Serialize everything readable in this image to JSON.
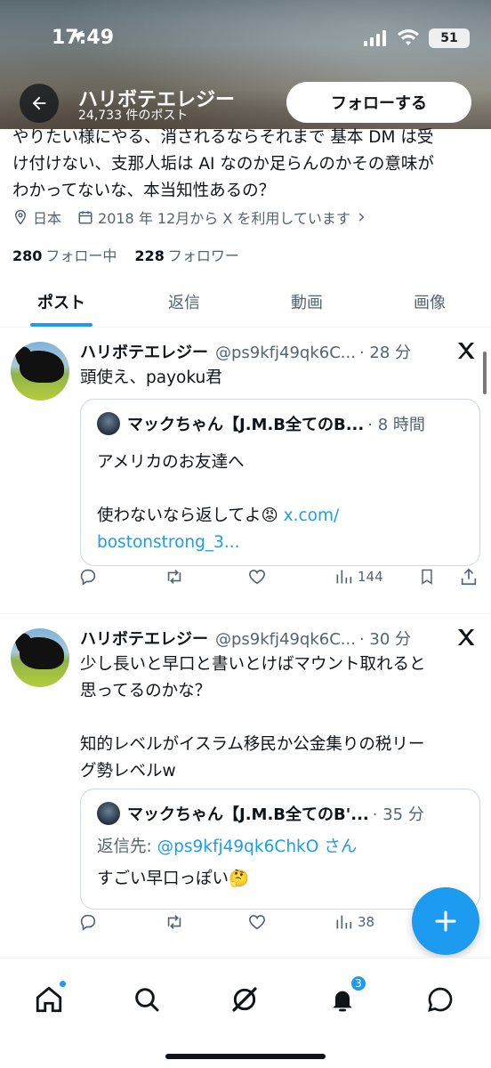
{
  "status_bar": {
    "time": "17:49",
    "battery": "51"
  },
  "header": {
    "name": "ハリボテエレジー",
    "post_count": "24,733 件のポスト",
    "follow_label": "フォローする"
  },
  "profile": {
    "bio_lines": [
      "やりたい様にやる、消されるならそれまで 基本 DM は受",
      "け付けない、支那人垢は AI なのか足らんのかその意味が",
      "わかってないな、本当知性あるの？"
    ],
    "location": "日本",
    "joined": "2018 年 12月から X を利用しています",
    "following_count": "280",
    "following_label": "フォロー中",
    "followers_count": "228",
    "followers_label": "フォロワー"
  },
  "tabs": [
    {
      "label": "ポスト",
      "active": true
    },
    {
      "label": "返信",
      "active": false
    },
    {
      "label": "動画",
      "active": false
    },
    {
      "label": "画像",
      "active": false
    }
  ],
  "posts": [
    {
      "name": "ハリボテエレジー",
      "handle": "@ps9kfj49qk6C...",
      "time": "· 28 分",
      "text_lines": [
        "頭使え、payoku君"
      ],
      "quote": {
        "name": "マックちゃん【J.M.B全てのB...",
        "time": "· 8 時間",
        "line1": "アメリカのお友達へ",
        "line2_prefix": "使わないなら返してよ😡 ",
        "line2_link": "x.com/",
        "line3_link": "bostonstrong_3..."
      },
      "views": "144"
    },
    {
      "name": "ハリボテエレジー",
      "handle": "@ps9kfj49qk6C...",
      "time": "· 30 分",
      "text_lines": [
        "少し長いと早口と書いとけばマウント取れると",
        "思ってるのかな？",
        "",
        "知的レベルがイスラム移民か公金集りの税リー",
        "グ勢レベルw"
      ],
      "quote": {
        "name": "マックちゃん【J.M.B全てのB'...",
        "time": "· 35 分",
        "reply_prefix": "返信先: ",
        "reply_handle": "@ps9kfj49qk6ChkO さん",
        "line1": "すごい早口っぽい🤔"
      },
      "views": "38"
    }
  ],
  "bottom_nav": {
    "notification_badge": "3"
  },
  "colors": {
    "accent": "#1d9bf0",
    "text": "#0f1419",
    "muted": "#536471"
  }
}
